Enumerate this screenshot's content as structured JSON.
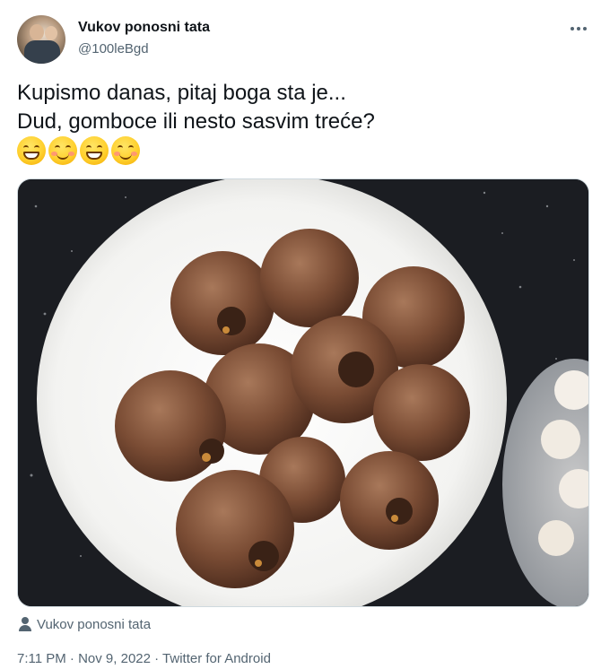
{
  "author": {
    "display_name": "Vukov ponosni tata",
    "handle": "@100leBgd"
  },
  "tweet": {
    "lines": [
      "Kupismo danas, pitaj boga sta je...",
      "Dud, gomboce ili nesto sasvim treće?"
    ],
    "emojis": [
      "grinning-face-icon",
      "smiling-face-icon",
      "grinning-face-icon",
      "smiling-face-icon"
    ]
  },
  "media": {
    "description_icon": "photo-of-medlar-fruits-on-plate"
  },
  "attribution": {
    "name": "Vukov ponosni tata",
    "icon": "person-icon"
  },
  "meta": {
    "text": "7:11 PM · Nov 9, 2022 · Twitter for Android"
  },
  "colors": {
    "primary_text": "#0f1419",
    "secondary_text": "#536471",
    "border": "#cfd9de"
  }
}
